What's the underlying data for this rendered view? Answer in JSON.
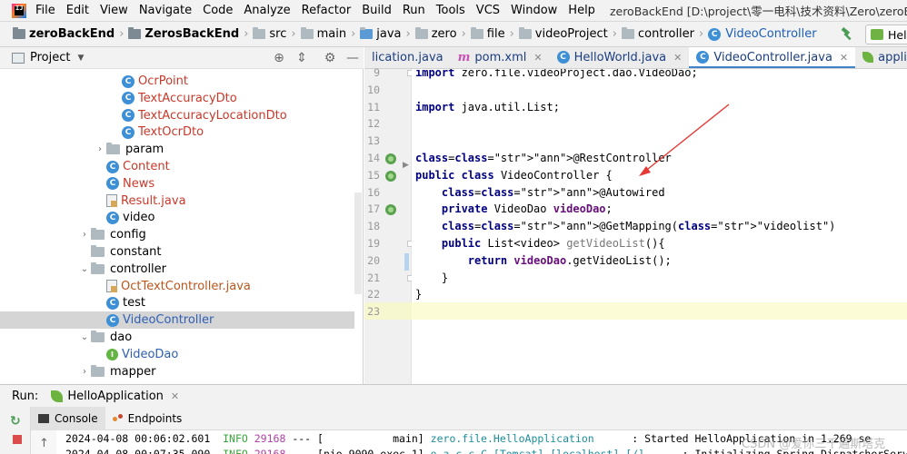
{
  "menu": {
    "items": [
      "File",
      "Edit",
      "View",
      "Navigate",
      "Code",
      "Analyze",
      "Refactor",
      "Build",
      "Run",
      "Tools",
      "VCS",
      "Window",
      "Help"
    ],
    "window_title": "zeroBackEnd [D:\\project\\零一电科\\技术资料\\Zero\\zeroBackEnd] - ...\\videoPro"
  },
  "breadcrumb": [
    "zeroBackEnd",
    "ZerosBackEnd",
    "src",
    "main",
    "java",
    "zero",
    "file",
    "videoProject",
    "controller",
    "VideoController"
  ],
  "run_config": {
    "label": "Hell"
  },
  "project_panel": {
    "title": "Project",
    "tree": [
      {
        "label": "OcrPoint",
        "indent": 3,
        "icon": "class",
        "color": "red",
        "arrow": ""
      },
      {
        "label": "TextAccuracyDto",
        "indent": 3,
        "icon": "class",
        "color": "red",
        "arrow": ""
      },
      {
        "label": "TextAccuracyLocationDto",
        "indent": 3,
        "icon": "class",
        "color": "red",
        "arrow": ""
      },
      {
        "label": "TextOcrDto",
        "indent": 3,
        "icon": "class",
        "color": "red",
        "arrow": ""
      },
      {
        "label": "param",
        "indent": 2,
        "icon": "folder",
        "color": "",
        "arrow": "›"
      },
      {
        "label": "Content",
        "indent": 2,
        "icon": "class",
        "color": "red",
        "arrow": ""
      },
      {
        "label": "News",
        "indent": 2,
        "icon": "class",
        "color": "red",
        "arrow": ""
      },
      {
        "label": "Result.java",
        "indent": 2,
        "icon": "file",
        "color": "red",
        "arrow": ""
      },
      {
        "label": "video",
        "indent": 2,
        "icon": "class",
        "color": "",
        "arrow": ""
      },
      {
        "label": "config",
        "indent": 1,
        "icon": "folder",
        "color": "",
        "arrow": "›"
      },
      {
        "label": "constant",
        "indent": 1,
        "icon": "folder",
        "color": "",
        "arrow": ""
      },
      {
        "label": "controller",
        "indent": 1,
        "icon": "folder",
        "color": "",
        "arrow": "⌄"
      },
      {
        "label": "OctTextController.java",
        "indent": 2,
        "icon": "file",
        "color": "brown",
        "arrow": ""
      },
      {
        "label": "test",
        "indent": 2,
        "icon": "class",
        "color": "",
        "arrow": ""
      },
      {
        "label": "VideoController",
        "indent": 2,
        "icon": "class",
        "color": "blue",
        "arrow": "",
        "selected": true
      },
      {
        "label": "dao",
        "indent": 1,
        "icon": "folder",
        "color": "",
        "arrow": "⌄"
      },
      {
        "label": "VideoDao",
        "indent": 2,
        "icon": "interface",
        "color": "blue",
        "arrow": ""
      },
      {
        "label": "mapper",
        "indent": 1,
        "icon": "folder",
        "color": "",
        "arrow": "›"
      }
    ]
  },
  "editor": {
    "tabs": [
      {
        "label": "lication.java",
        "icon": "",
        "active": false
      },
      {
        "label": "pom.xml",
        "icon": "m",
        "active": false
      },
      {
        "label": "HelloWorld.java",
        "icon": "class",
        "active": false
      },
      {
        "label": "VideoController.java",
        "icon": "class",
        "active": true
      },
      {
        "label": "application.yml",
        "icon": "leaf",
        "active": false
      }
    ],
    "line_numbers": [
      9,
      10,
      11,
      12,
      13,
      14,
      15,
      16,
      17,
      18,
      19,
      20,
      21,
      22,
      23
    ],
    "code": [
      "import zero.file.videoProject.dao.VideoDao;",
      "",
      "import java.util.List;",
      "",
      "",
      "@RestController",
      "public class VideoController {",
      "    @Autowired",
      "    private VideoDao videoDao;",
      "    @GetMapping(\"videolist\")",
      "    public List<video> getVideoList(){",
      "        return videoDao.getVideoList();",
      "    }",
      "}",
      ""
    ]
  },
  "run_panel": {
    "label": "Run:",
    "tab": "HelloApplication",
    "subtabs": [
      "Console",
      "Endpoints"
    ],
    "log": [
      {
        "time": "2024-04-08 00:06:02.601",
        "level": "INFO",
        "pid": "29168",
        "sep": "---",
        "thread": "[           main]",
        "logger": "zero.file.HelloApplication",
        "message": ": Started HelloApplication in 1.269 se"
      },
      {
        "time": "2024-04-08 00:07:35.090",
        "level": "INFO",
        "pid": "29168",
        "sep": "---",
        "thread": "[nio-9090-exec-1]",
        "logger": "o.a.c.c.C.[Tomcat].[localhost].[/]",
        "message": ": Initializing Spring DispatcherServle"
      }
    ]
  },
  "watermark": "CSDN @爱你三千遍斯塔克"
}
